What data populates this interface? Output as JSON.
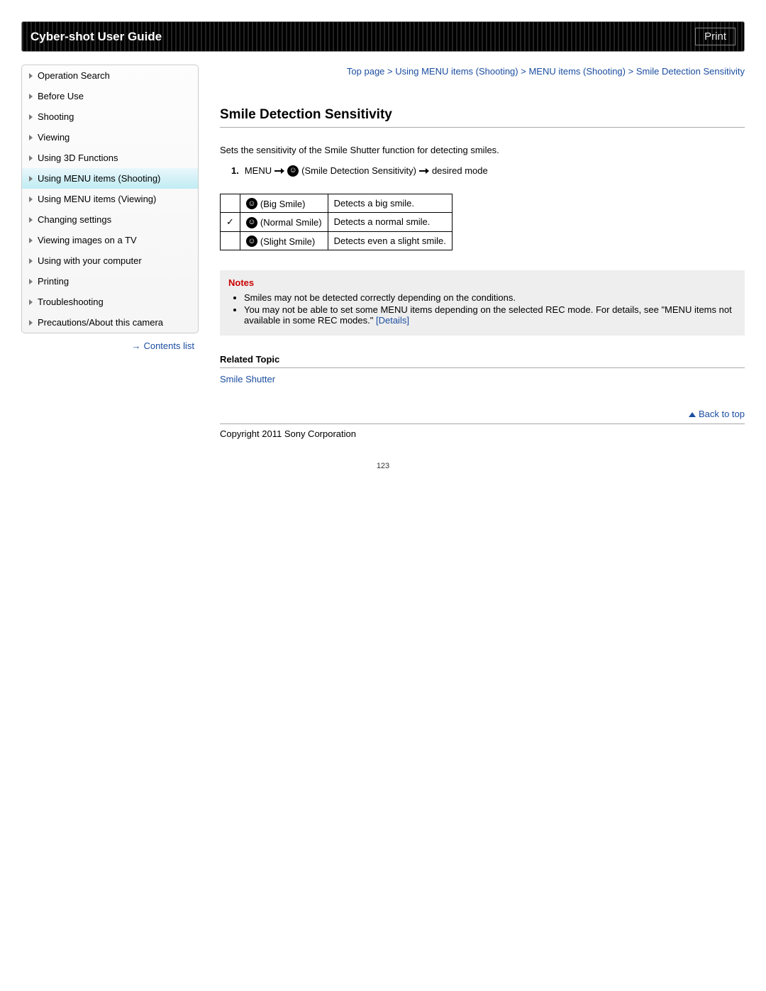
{
  "header": {
    "title": "Cyber-shot User Guide",
    "print": "Print"
  },
  "sidebar": {
    "items": [
      {
        "label": "Operation Search"
      },
      {
        "label": "Before Use"
      },
      {
        "label": "Shooting"
      },
      {
        "label": "Viewing"
      },
      {
        "label": "Using 3D Functions"
      },
      {
        "label": "Using MENU items (Shooting)",
        "active": true
      },
      {
        "label": "Using MENU items (Viewing)"
      },
      {
        "label": "Changing settings"
      },
      {
        "label": "Viewing images on a TV"
      },
      {
        "label": "Using with your computer"
      },
      {
        "label": "Printing"
      },
      {
        "label": "Troubleshooting"
      },
      {
        "label": "Precautions/About this camera"
      }
    ],
    "contents_link": "Contents list"
  },
  "breadcrumb": {
    "top": "Top page",
    "sep": " > ",
    "a": "Using MENU items (Shooting)",
    "b": "MENU items (Shooting)",
    "current": "Smile Detection Sensitivity"
  },
  "title": "Smile Detection Sensitivity",
  "intro": "Sets the sensitivity of the Smile Shutter function for detecting smiles.",
  "step": {
    "num": "1.",
    "menu": "MENU",
    "paren": "(Smile Detection Sensitivity)",
    "desired": "desired mode"
  },
  "table": {
    "rows": [
      {
        "check": "",
        "label": "(Big Smile)",
        "desc": "Detects a big smile."
      },
      {
        "check": "✓",
        "label": "(Normal Smile)",
        "desc": "Detects a normal smile."
      },
      {
        "check": "",
        "label": "(Slight Smile)",
        "desc": "Detects even a slight smile."
      }
    ]
  },
  "notes": {
    "heading": "Notes",
    "items": [
      "Smiles may not be detected correctly depending on the conditions.",
      "You may not be able to set some MENU items depending on the selected REC mode. For details, see \"MENU items not available in some REC modes.\" "
    ],
    "details": "[Details]"
  },
  "related": {
    "heading": "Related Topic",
    "link": "Smile Shutter"
  },
  "back_to_top": "Back to top",
  "copyright": "Copyright 2011 Sony Corporation",
  "page_number": "123"
}
